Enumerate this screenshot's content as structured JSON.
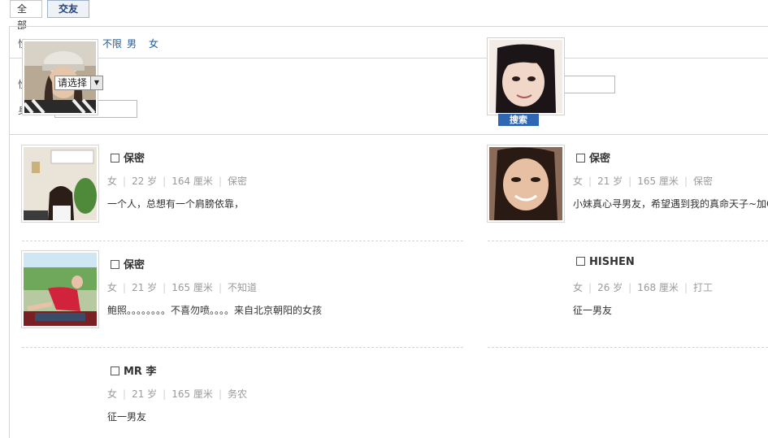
{
  "tabs": [
    {
      "label": "全部",
      "active": false
    },
    {
      "label": "交友",
      "active": true
    }
  ],
  "filters": {
    "gender_prefix": "性",
    "gender_options": [
      "不限",
      "男",
      "女"
    ],
    "row2_prefix": "性",
    "row3_prefix": "身",
    "select_value": "请选择",
    "search_label": "搜索"
  },
  "profiles": [
    {
      "name": "保密",
      "gender": "女",
      "age": "22 岁",
      "height": "164 厘米",
      "job": "保密",
      "desc": "一个人，总想有一个肩膀依靠，",
      "photo": "room-icon"
    },
    {
      "name": "保密",
      "gender": "女",
      "age": "21 岁",
      "height": "165 厘米",
      "job": "保密",
      "desc": "小妹真心寻男友，希望遇到我的真命天子~加QQ",
      "photo": "portrait-icon"
    },
    {
      "name": "保密",
      "gender": "女",
      "age": "21 岁",
      "height": "165 厘米",
      "job": "不知道",
      "desc": "鲍照。。。。。。。。不喜勿喷。。。。来自北京朝阳的女孩",
      "photo": "outdoor-icon"
    },
    {
      "name": "HISHEN",
      "gender": "女",
      "age": "26 岁",
      "height": "168 厘米",
      "job": "打工",
      "desc": "征一男友",
      "photo": ""
    },
    {
      "name": "MR 李",
      "gender": "女",
      "age": "21 岁",
      "height": "165 厘米",
      "job": "务农",
      "desc": "征一男友",
      "photo": ""
    }
  ]
}
